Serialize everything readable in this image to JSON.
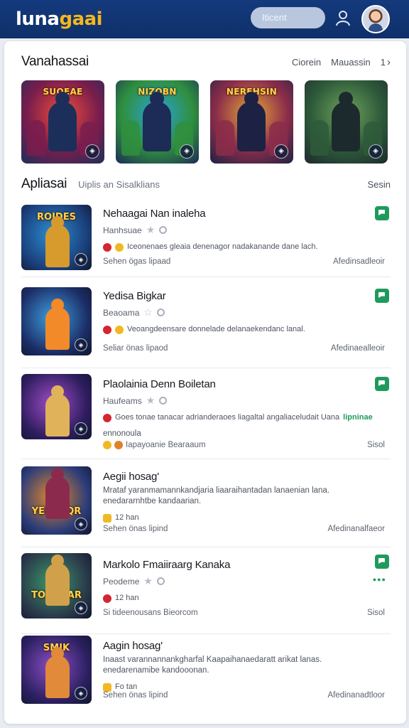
{
  "header": {
    "logo_main": "luna",
    "logo_accent": "gaai",
    "search_placeholder": "Iticent"
  },
  "featured": {
    "title": "Vanahassai",
    "link1": "Ciorein",
    "link2": "Mauassin",
    "page": "1",
    "tiles": [
      {
        "label": "SUOEAE",
        "colors": [
          "#f04e3a",
          "#7a1d4d",
          "#1c2f5a"
        ]
      },
      {
        "label": "NIZOBN",
        "colors": [
          "#2aa3d8",
          "#2f8f3e",
          "#1d2b57"
        ]
      },
      {
        "label": "NEREHSIN",
        "colors": [
          "#e8a63a",
          "#8b2d4a",
          "#1d2244"
        ]
      },
      {
        "label": "",
        "colors": [
          "#6ea35a",
          "#2e5a3a",
          "#1c2a2e"
        ]
      }
    ]
  },
  "apps": {
    "title": "Apliasai",
    "subtitle": "Uiplis an Sisalklians",
    "right": "Sesin",
    "items": [
      {
        "thumb_label": "ROIDES",
        "colors": [
          "#2a8fd6",
          "#1b3f7a",
          "#d79a2c"
        ],
        "name": "Nehaagai Nan inaleha",
        "developer": "Hanhsuae",
        "desc": "Iceonenaes gleaia denenagor nadakanande dane lach.",
        "meta_left": "Sehen ögas lipaad",
        "meta_right": "Afedinsadleoir"
      },
      {
        "thumb_label": "",
        "colors": [
          "#3fa0e0",
          "#1b2d66",
          "#f28a2a"
        ],
        "name": "Yedisa Bigkar",
        "developer": "Beaoama",
        "desc": "Veoangdeensare donnelade delanaekendanc lanal.",
        "meta_left": "Seliar önas lipaod",
        "meta_right": "Afedinaealleoir"
      },
      {
        "thumb_label": "",
        "colors": [
          "#a14ec9",
          "#2e1d5e",
          "#e0b35a"
        ],
        "name": "Plaolainia Denn Boiletan",
        "developer": "Haufeams",
        "desc": "Goes tonae tanacar adrianderaoes liagaltal angaliaceludait Uana",
        "desc_tag": "lipninae",
        "desc2": "ennonoula",
        "meta_left": "Iapayoanie Bearaaum",
        "meta_right": "Sisol"
      },
      {
        "thumb_label": "YENSAQR",
        "colors": [
          "#e5892a",
          "#2b3c7a",
          "#8c2a4d"
        ],
        "name": "Aegii hosag'",
        "developer": "",
        "desc": "Mrataf yaranmamannkandjaria liaaraihantadan lanaenian lana.",
        "desc2": "enedararnhtbe kandaarian.",
        "meta_small": "12 han",
        "meta_left": "Sehen önas lipind",
        "meta_right": "Afedinanalfaeor"
      },
      {
        "thumb_label": "TOUUAAR",
        "colors": [
          "#3b9a6a",
          "#2a3a4a",
          "#d0a14a"
        ],
        "name": "Markolo Fmaiiraarg Kanaka",
        "developer": "Peodeme",
        "meta_small": "12 han",
        "meta_left": "Si tideenousans Bieorcom",
        "meta_right": "Sisol"
      },
      {
        "thumb_label": "SMIK",
        "colors": [
          "#8d4ec8",
          "#2b2060",
          "#e08a3a"
        ],
        "name": "Aagin hosag'",
        "developer": "",
        "desc": "Inaast varannannankgharfal Kaapaihanaedaratt arikat lanas.",
        "desc2": "enedarenamibe kandooonan.",
        "meta_small": "Fo tan",
        "meta_left": "Sehen önas lipind",
        "meta_right": "Afedinanadtloor"
      }
    ]
  },
  "colors": {
    "header_bg": "#143a7d",
    "accent_gold": "#f4b81e",
    "badge_green": "#1f9a5c"
  },
  "icons": [
    "user-icon",
    "avatar",
    "star-icon",
    "pin-icon",
    "flag-icon",
    "chevron-right-icon",
    "badge-icon"
  ]
}
